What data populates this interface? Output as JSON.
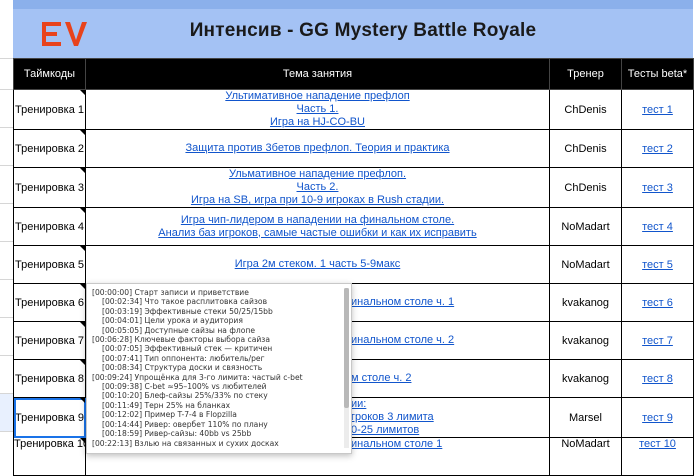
{
  "header": {
    "logo_text": "EV",
    "title": "Интенсив - GG Mystery Battle Royale"
  },
  "table": {
    "columns": [
      "Таймкоды",
      "Тема занятия",
      "Тренер",
      "Тесты beta*"
    ],
    "rows": [
      {
        "timecode": "Тренировка 1",
        "topic": [
          "Ультимативное нападение префлоп",
          "Часть 1.",
          "Игра на HJ-CO-BU"
        ],
        "trainer": "ChDenis",
        "test": "тест 1"
      },
      {
        "timecode": "Тренировка 2",
        "topic": [
          "Защита против 3бетов префлоп. Теория и практика"
        ],
        "trainer": "ChDenis",
        "test": "тест 2"
      },
      {
        "timecode": "Тренировка 3",
        "topic": [
          "Ульмативное нападение префлоп.",
          "Часть 2.",
          "Игра на SB, игра при 10-9 игроках в Rush стадии."
        ],
        "trainer": "ChDenis",
        "test": "тест 3"
      },
      {
        "timecode": "Тренировка 4",
        "topic": [
          "Игра чип-лидером в нападении на финальном столе.",
          "Анализ баз игроков, самые частые ошибки и как их исправить"
        ],
        "trainer": "NoMadart",
        "test": "тест 4"
      },
      {
        "timecode": "Тренировка 5",
        "topic": [
          "Игра 2м стеком. 1 часть 5-9макс"
        ],
        "trainer": "NoMadart",
        "test": "тест 5"
      },
      {
        "timecode": "Тренировка 6",
        "topic": [
          "инальном столе ч. 1"
        ],
        "trainer": "kvakanog",
        "test": "тест 6"
      },
      {
        "timecode": "Тренировка 7",
        "topic": [
          "инальном столе ч. 2"
        ],
        "trainer": "kvakanog",
        "test": "тест 7"
      },
      {
        "timecode": "Тренировка 8",
        "topic": [
          "м столе  ч. 2"
        ],
        "trainer": "kvakanog",
        "test": "тест 8"
      },
      {
        "timecode": "Тренировка 9",
        "topic": [
          "ии:",
          "гроков 3 лимита",
          "0-25 лимитов"
        ],
        "trainer": "Marsel",
        "test": "тест 9"
      },
      {
        "timecode": "Тренировка 10",
        "topic": [
          "инальном столе 1"
        ],
        "trainer": "NoMadart",
        "test": "тест 10"
      }
    ]
  },
  "popup": {
    "lines": [
      {
        "t": "[00:00:00] Старт записи и приветствие",
        "indent": false
      },
      {
        "t": "[00:02:34] Что такое расплитовка сайзов",
        "indent": true
      },
      {
        "t": "[00:03:19] Эффективные стеки 50/25/15bb",
        "indent": true
      },
      {
        "t": "[00:04:01] Цели урока и аудитория",
        "indent": true
      },
      {
        "t": "[00:05:05] Доступные сайзы на флопе",
        "indent": true
      },
      {
        "t": "[00:06:28] Ключевые факторы выбора сайза",
        "indent": false
      },
      {
        "t": "[00:07:05] Эффективный стек — критичен",
        "indent": true
      },
      {
        "t": "[00:07:41] Тип оппонента: любитель/рег",
        "indent": true
      },
      {
        "t": "[00:08:34] Структура доски и связность",
        "indent": true
      },
      {
        "t": "[00:09:24] Упрощёнка для 3-го лимита: частый c-bet",
        "indent": false
      },
      {
        "t": "[00:09:38] C-bet ≈95–100% vs любителей",
        "indent": true
      },
      {
        "t": "[00:10:20] Блеф-сайзы 25%/33% по стеку",
        "indent": true
      },
      {
        "t": "[00:11:49] Терн 25% на бланках",
        "indent": true
      },
      {
        "t": "[00:12:02] Пример T-7-4 в Flopzilla",
        "indent": true
      },
      {
        "t": "[00:14:44] Ривер: овербет 110% по плану",
        "indent": true
      },
      {
        "t": "[00:18:59] Ривер-сайзы: 40bb vs 25bb",
        "indent": true
      },
      {
        "t": "[00:22:13] Взлью на связанных и сухих досках",
        "indent": false
      }
    ]
  },
  "colors": {
    "title_bg": "#a4c2f4",
    "logo": "#e8431c",
    "link": "#1155cc",
    "header_bg": "#000000"
  }
}
